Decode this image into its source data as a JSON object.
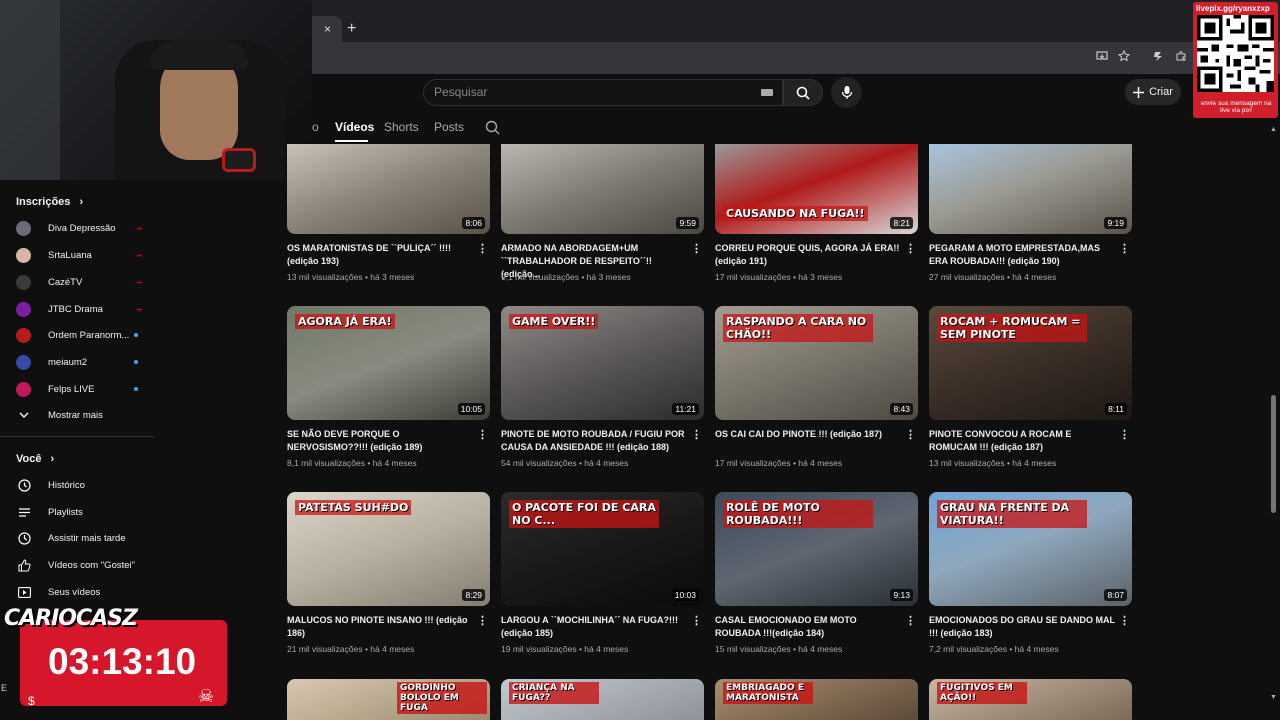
{
  "browser": {
    "tab_close": "×",
    "new_tab": "+"
  },
  "header": {
    "search_placeholder": "Pesquisar",
    "create_label": "Criar"
  },
  "channel_tabs": [
    {
      "label": "o",
      "active": false
    },
    {
      "label": "Vídeos",
      "active": true
    },
    {
      "label": "Shorts",
      "active": false
    },
    {
      "label": "Posts",
      "active": false
    }
  ],
  "sidebar": {
    "subscriptions_heading": "Inscrições",
    "subscriptions": [
      {
        "label": "Diva Depressão",
        "status": "live",
        "avatar_color": "#6b6b7a"
      },
      {
        "label": "SrtaLuana",
        "status": "live",
        "avatar_color": "#d8b6a4"
      },
      {
        "label": "CazéTV",
        "status": "live",
        "avatar_color": "#3a3a3a"
      },
      {
        "label": "JTBC Drama",
        "status": "live",
        "avatar_color": "#7b1fa2"
      },
      {
        "label": "Ordem Paranorm...",
        "status": "new",
        "avatar_color": "#b71c1c"
      },
      {
        "label": "meiaum2",
        "status": "new",
        "avatar_color": "#3949ab"
      },
      {
        "label": "Felps LIVE",
        "status": "new",
        "avatar_color": "#c2185b"
      }
    ],
    "show_more": "Mostrar mais",
    "you_heading": "Você",
    "you_items": [
      {
        "label": "Histórico",
        "icon": "history-icon"
      },
      {
        "label": "Playlists",
        "icon": "playlists-icon"
      },
      {
        "label": "Assistir mais tarde",
        "icon": "watch-later-icon"
      },
      {
        "label": "Vídeos com \"Gostei\"",
        "icon": "like-icon"
      },
      {
        "label": "Seus vídeos",
        "icon": "your-videos-icon"
      }
    ]
  },
  "videos": [
    {
      "title": "OS MARATONISTAS DE ``PULIÇA´´ !!!! (edição 193)",
      "views": "13 mil visualizações",
      "age": "há 3 meses",
      "duration": "8:06",
      "overlay": "",
      "bg": "linear-gradient(160deg,#c9c2b7 0%,#8a8378 50%,#595248 100%)"
    },
    {
      "title": "ARMADO NA ABORDAGEM+UM ``TRABALHADOR DE RESPEITO´´!! (edição...",
      "views": "9,1 mil visualizações",
      "age": "há 3 meses",
      "duration": "9:59",
      "overlay": "",
      "bg": "linear-gradient(160deg,#b9b7b0 0%,#7d7a72 50%,#4a4842 100%)"
    },
    {
      "title": "CORREU PORQUE QUIS, AGORA JÁ ERA!! (edição 191)",
      "views": "17 mil visualizações",
      "age": "há 3 meses",
      "duration": "8:21",
      "overlay": "CAUSANDO NA FUGA!!",
      "bg": "linear-gradient(160deg,#9a9a9a 0%,#b01a1a 45%,#d8d8d8 100%)"
    },
    {
      "title": "PEGARAM A MOTO EMPRESTADA,MAS ERA ROUBADA!!! (edição 190)",
      "views": "27 mil visualizações",
      "age": "há 4 meses",
      "duration": "9:19",
      "overlay": "",
      "bg": "linear-gradient(160deg,#a8c4df 0%,#9b9b93 45%,#5a544c 100%)"
    },
    {
      "title": "SE NÃO DEVE PORQUE O NERVOSISMO??!!! (edição 189)",
      "views": "8,1 mil visualizações",
      "age": "há 4 meses",
      "duration": "10:05",
      "overlay": "AGORA JÁ ERA!",
      "bg": "linear-gradient(160deg,#6f7a66 0%,#8a8a80 50%,#3d3d38 100%)"
    },
    {
      "title": "PINOTE DE MOTO ROUBADA / FUGIU POR CAUSA DA ANSIEDADE !!! (edição 188)",
      "views": "54 mil visualizações",
      "age": "há 4 meses",
      "duration": "11:21",
      "overlay": "GAME OVER!!",
      "bg": "linear-gradient(160deg,#8d8a86 0%,#5a5757 50%,#2c2b2b 100%)"
    },
    {
      "title": "OS CAI CAI DO PINOTE !!! (edição 187)",
      "views": "17 mil visualizações",
      "age": "há 4 meses",
      "duration": "8:43",
      "overlay": "RASPANDO A CARA NO CHÃO!!",
      "bg": "linear-gradient(160deg,#a39d91 0%,#7a756b 50%,#4d4942 100%)"
    },
    {
      "title": "PINOTE CONVOCOU A ROCAM E ROMUCAM !!! (edição 187)",
      "views": "13 mil visualizações",
      "age": "há 4 meses",
      "duration": "8:11",
      "overlay": "ROCAM + ROMUCAM = SEM PINOTE",
      "bg": "linear-gradient(160deg,#5a4a3c 0%,#3a2e26 50%,#1e1714 100%)"
    },
    {
      "title": "MALUCOS NO PINOTE INSANO !!! (edição 186)",
      "views": "21 mil visualizações",
      "age": "há 4 meses",
      "duration": "8:29",
      "overlay": "PATETAS SUH#DO",
      "bg": "linear-gradient(160deg,#dcd6c8 0%,#b7b0a1 50%,#847e70 100%)"
    },
    {
      "title": "LARGOU A ``MOCHILINHA´´ NA FUGA?!!! (edição 185)",
      "views": "19 mil visualizações",
      "age": "há 4 meses",
      "duration": "10:03",
      "overlay": "O PACOTE FOI DE CARA NO C...",
      "bg": "linear-gradient(160deg,#2d2b28 0%,#1a1917 50%,#0a0a09 100%)"
    },
    {
      "title": "CASAL EMOCIONADO EM MOTO ROUBADA !!!(edição 184)",
      "views": "15 mil visualizações",
      "age": "há 4 meses",
      "duration": "9:13",
      "overlay": "ROLÊ DE MOTO ROUBADA!!!",
      "bg": "linear-gradient(160deg,#3c4a5a 0%,#5e6670 50%,#2a2f36 100%)"
    },
    {
      "title": "EMOCIONADOS DO GRAU SE DANDO MAL !!! (edição 183)",
      "views": "7,2 mil visualizações",
      "age": "há 4 meses",
      "duration": "8:07",
      "overlay": "GRAU NA FRENTE DA VIATURA!!",
      "bg": "linear-gradient(160deg,#6fa6d8 0%,#8ea7bc 45%,#5b6268 100%)"
    }
  ],
  "next_row_overlays": [
    "GORDINHO BOLOLO EM FUGA",
    "CRIANÇA NA FUGA??",
    "EMBRIAGADO E MARATONISTA",
    "FUGITIVOS EM AÇÃO!!"
  ],
  "overlay": {
    "qr_caption_top": "livepix.gg/ryanxzxp",
    "qr_caption_bottom": "envie sua mensagem na live via pix!",
    "logo": "CARIOCASZ",
    "timer": "03:13:10"
  }
}
